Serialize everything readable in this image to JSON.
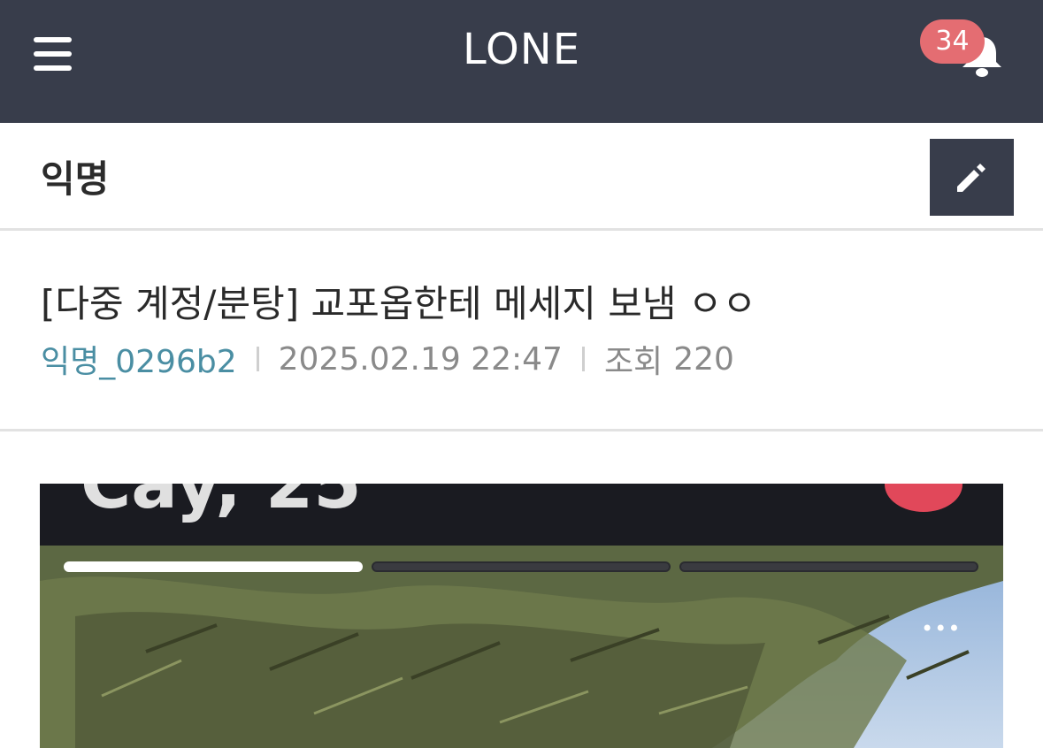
{
  "app": {
    "logo": "LONE",
    "notification_count": "34",
    "icons": {
      "menu": "hamburger-menu-icon",
      "bell": "bell-icon",
      "write": "pencil-icon"
    },
    "colors": {
      "topbar": "#383d4b",
      "badge": "#e46d72",
      "author": "#4a8ea3"
    }
  },
  "board": {
    "name": "익명"
  },
  "post": {
    "title": "[다중 계정/분탕] 교포옵한테 메세지 보냄 ㅇㅇ",
    "author": "익명_0296b2",
    "date": "2025.02.19 22:47",
    "views_label": "조회",
    "views": "220"
  },
  "content": {
    "image_text": "Cay, 25",
    "story_progress_segments": 3,
    "story_progress_filled": 1,
    "more_label": "•••"
  }
}
